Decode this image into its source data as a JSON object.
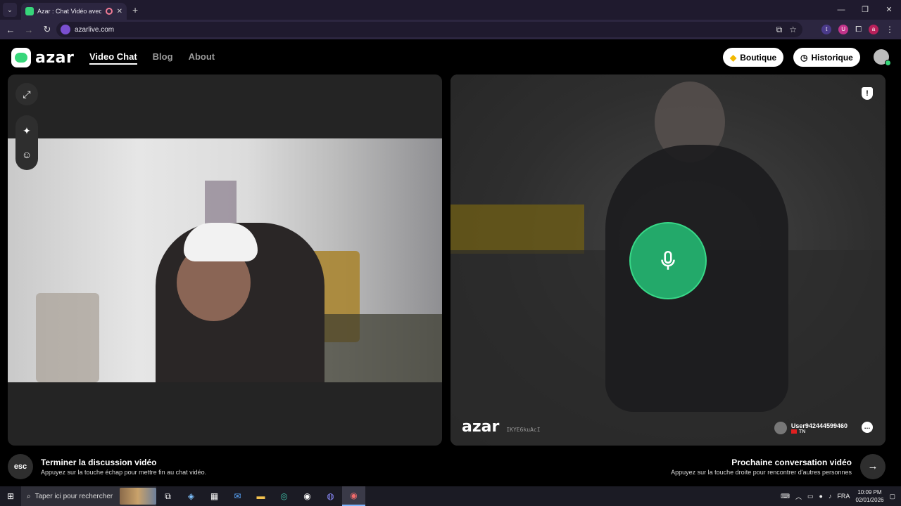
{
  "browser": {
    "tab_title": "Azar : Chat Vidéo avec de n",
    "url": "azarlive.com",
    "new_tab": "+",
    "extension_t": "t",
    "extension_a": "a"
  },
  "nav": {
    "logo_text": "azar",
    "items": [
      {
        "label": "Video Chat"
      },
      {
        "label": "Blog"
      },
      {
        "label": "About"
      }
    ],
    "boutique_label": "Boutique",
    "historique_label": "Historique"
  },
  "remote": {
    "watermark": "azar",
    "session_code": "IKYE6kuAcI",
    "username": "User942444599460",
    "country": "TN"
  },
  "controls": {
    "esc_key": "esc",
    "end_title": "Terminer la discussion vidéo",
    "end_subtitle": "Appuyez sur la touche échap pour mettre fin au chat vidéo.",
    "next_title": "Prochaine conversation vidéo",
    "next_subtitle": "Appuyez sur la touche droite pour rencontrer d'autres personnes"
  },
  "taskbar": {
    "search_placeholder": "Taper ici pour rechercher",
    "language": "FRA",
    "time": "10:09 PM",
    "date": "02/01/2026"
  },
  "colors": {
    "accent_green": "#23a96a",
    "background": "#000000"
  }
}
